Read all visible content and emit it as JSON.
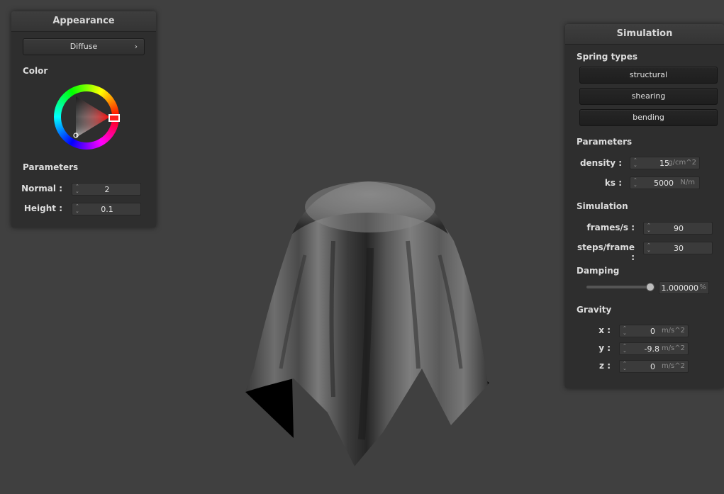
{
  "appearance": {
    "title": "Appearance",
    "shader_button": "Diffuse",
    "shader_chevron": "›",
    "color_label": "Color",
    "parameters_label": "Parameters",
    "normal_label": "Normal :",
    "normal_value": "2",
    "height_label": "Height :",
    "height_value": "0.1",
    "selected_color": "#ff0000"
  },
  "simulation": {
    "title": "Simulation",
    "spring_types_label": "Spring types",
    "spring_buttons": [
      "structural",
      "shearing",
      "bending"
    ],
    "parameters_label": "Parameters",
    "density_label": "density :",
    "density_value": "15",
    "density_unit": "g/cm^2",
    "ks_label": "ks :",
    "ks_value": "5000",
    "ks_unit": "N/m",
    "simulation_label": "Simulation",
    "fps_label": "frames/s :",
    "fps_value": "90",
    "steps_label": "steps/frame :",
    "steps_value": "30",
    "damping_label": "Damping",
    "damping_value": "1.000000",
    "damping_unit": "%",
    "damping_slider_fraction": 1.0,
    "gravity_label": "Gravity",
    "gx_label": "x :",
    "gx_value": "0",
    "gy_label": "y :",
    "gy_value": "-9.8",
    "gz_label": "z :",
    "gz_value": "0",
    "gravity_unit": "m/s^2"
  }
}
